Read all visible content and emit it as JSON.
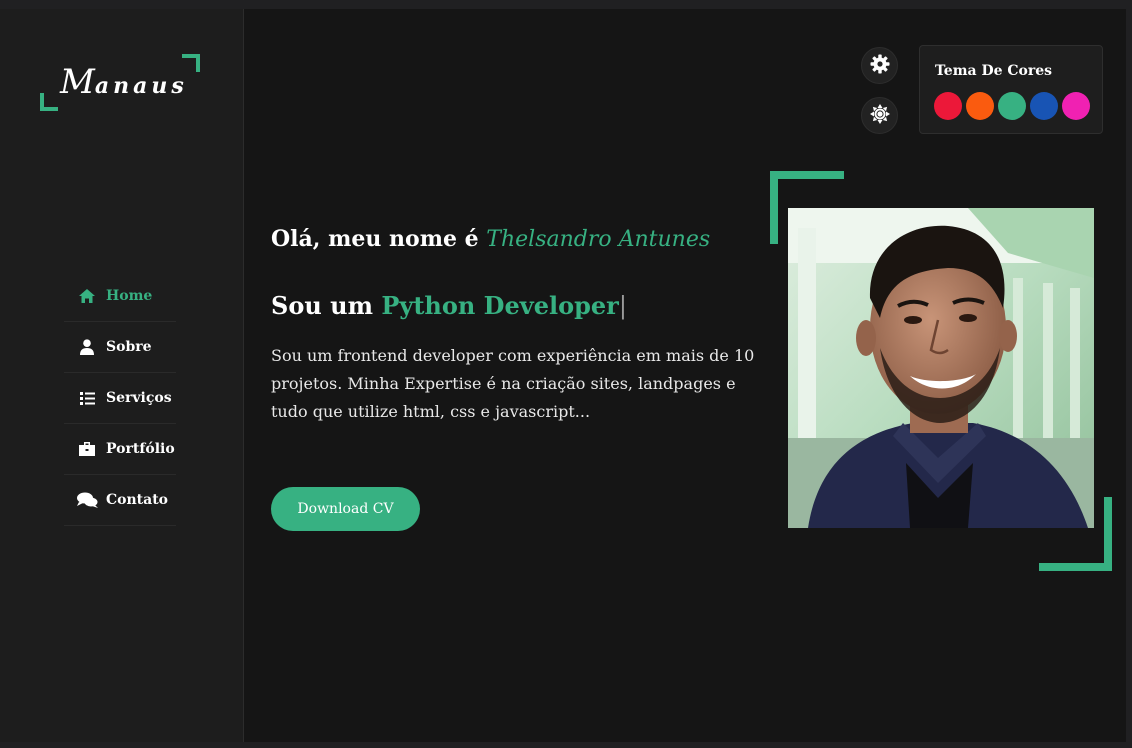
{
  "logo": {
    "initial": "M",
    "rest": "anaus"
  },
  "nav": [
    {
      "label": "Home",
      "icon": "home-icon",
      "active": true
    },
    {
      "label": "Sobre",
      "icon": "user-icon",
      "active": false
    },
    {
      "label": "Serviços",
      "icon": "list-icon",
      "active": false
    },
    {
      "label": "Portfólio",
      "icon": "briefcase-icon",
      "active": false
    },
    {
      "label": "Contato",
      "icon": "chat-icon",
      "active": false
    }
  ],
  "theme": {
    "title": "Tema De Cores",
    "colors": [
      "#ec1839",
      "#fa5b0f",
      "#37b182",
      "#1854b4",
      "#f021b2"
    ]
  },
  "hero": {
    "greeting_prefix": "Olá, meu nome é ",
    "name": "Thelsandro Antunes",
    "role_prefix": "Sou um ",
    "role": "Python Developer",
    "description": "Sou um frontend developer com experiência em mais de 10 projetos. Minha Expertise é na criação sites, landpages e tudo que utilize html, css e javascript...",
    "cv_button": "Download CV"
  },
  "accent_color": "#37b182"
}
